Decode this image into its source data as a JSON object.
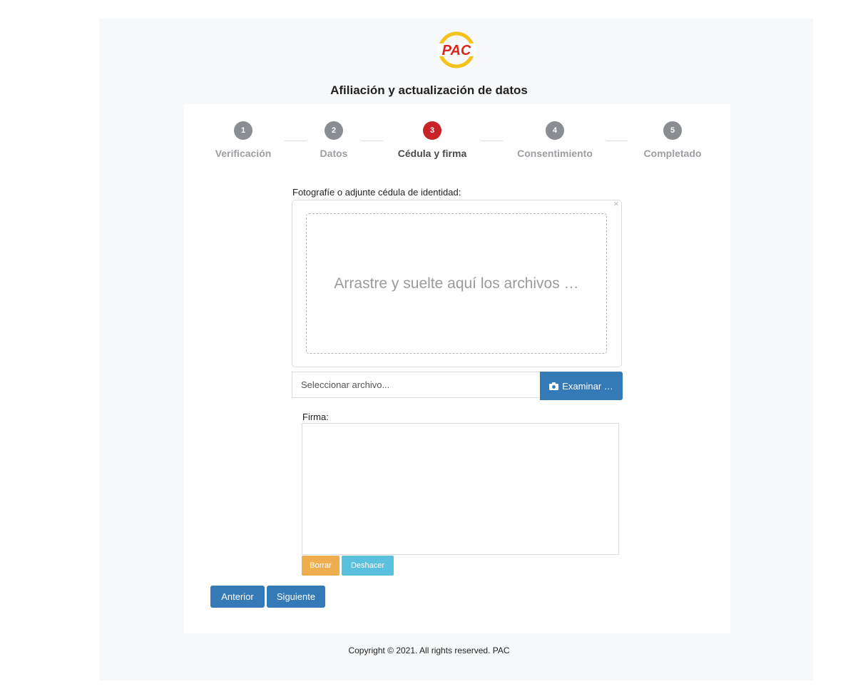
{
  "brand": {
    "logo_text": "PAC",
    "logo_colors": {
      "ring": "#f6c21c",
      "text": "#d9261c"
    }
  },
  "page_title": "Afiliación y actualización de datos",
  "steps": [
    {
      "number": "1",
      "label": "Verificación",
      "state": "inactive"
    },
    {
      "number": "2",
      "label": "Datos",
      "state": "inactive"
    },
    {
      "number": "3",
      "label": "Cédula y firma",
      "state": "active"
    },
    {
      "number": "4",
      "label": "Consentimiento",
      "state": "inactive"
    },
    {
      "number": "5",
      "label": "Completado",
      "state": "inactive"
    }
  ],
  "upload": {
    "label": "Fotografíe o adjunte cédula de identidad:",
    "close_glyph": "×",
    "drop_text": "Arrastre y suelte aquí los archivos …",
    "file_placeholder": "Seleccionar archivo...",
    "browse_label": "Examinar …",
    "browse_icon": "camera-icon"
  },
  "signature": {
    "label": "Firma:",
    "clear_label": "Borrar",
    "undo_label": "Deshacer"
  },
  "nav": {
    "prev_label": "Anterior",
    "next_label": "Siguiente"
  },
  "footer": {
    "copyright": "Copyright © 2021. All rights reserved. PAC"
  },
  "colors": {
    "active_step": "#c8222a",
    "inactive_step": "#8a8d91",
    "primary": "#337ab7",
    "warning": "#f0ad4e",
    "info": "#5bc0de"
  }
}
